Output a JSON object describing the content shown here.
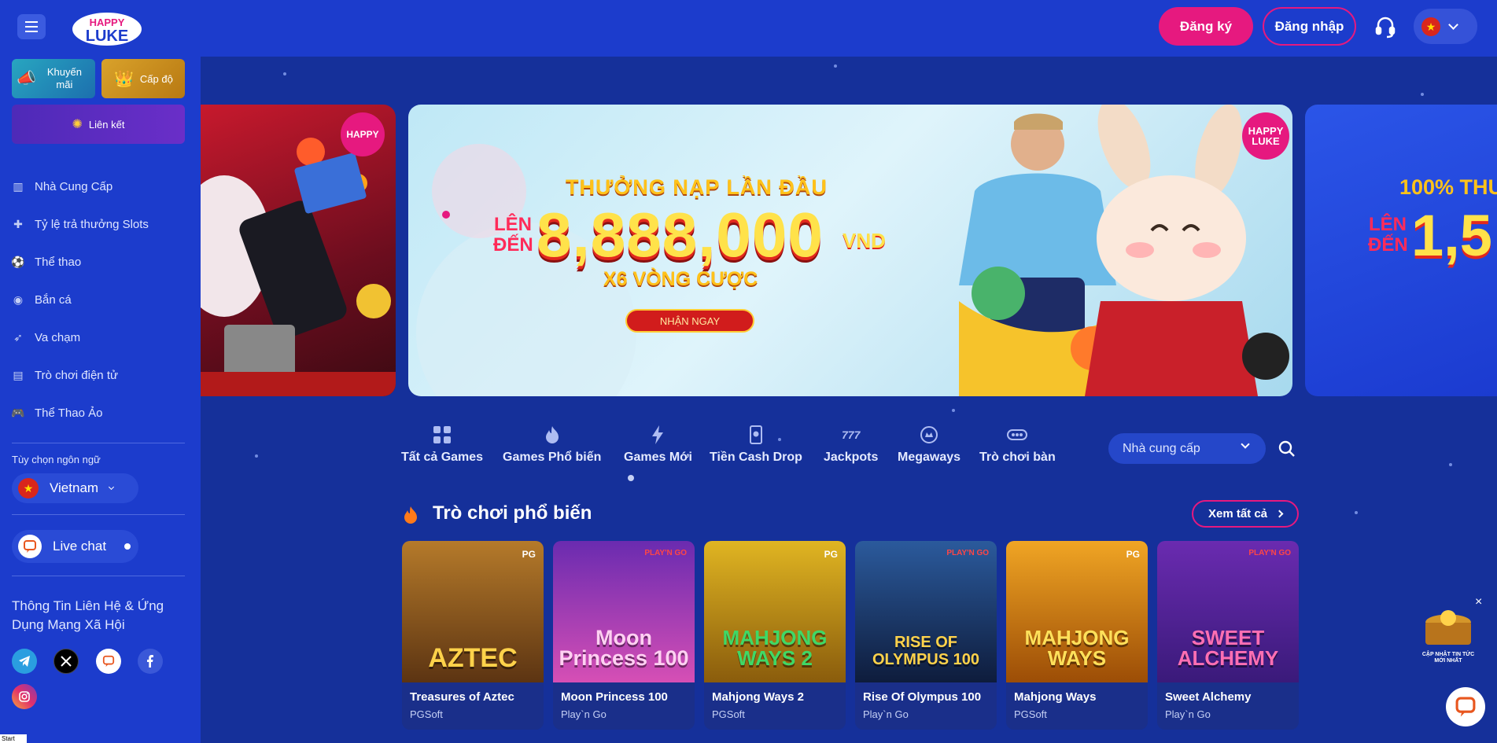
{
  "header": {
    "logo_text": "HAPPY LUKE",
    "register_label": "Đăng ký",
    "login_label": "Đăng nhập",
    "flag_color": "#d9261c"
  },
  "sidebar": {
    "promo_label": "Khuyến mãi",
    "level_label": "Cấp độ",
    "affiliate_label": "Liên kết",
    "items": [
      {
        "label": "Nhà Cung Cấp",
        "icon": "provider-icon"
      },
      {
        "label": "Tỷ lệ trả thưởng Slots",
        "icon": "puzzle-icon"
      },
      {
        "label": "Thể thao",
        "icon": "soccer-ball-icon"
      },
      {
        "label": "Bắn cá",
        "icon": "fish-icon"
      },
      {
        "label": "Va chạm",
        "icon": "rocket-icon"
      },
      {
        "label": "Trò chơi điện tử",
        "icon": "slot-machine-icon"
      },
      {
        "label": "Thể Thao Ảo",
        "icon": "gamepad-icon"
      }
    ],
    "language_label": "Tùy chọn ngôn ngữ",
    "language_value": "Vietnam",
    "livechat_label": "Live chat",
    "contact_title": "Thông Tin Liên Hệ & Ứng Dụng Mạng Xã Hội"
  },
  "banner": {
    "headline": "THƯỞNG NẠP LẦN ĐẦU",
    "prefix_line1": "LÊN",
    "prefix_line2": "ĐẾN",
    "amount": "8,888,000",
    "unit": "VND",
    "subline": "X6 VÒNG CƯỢC",
    "cta": "NHẬN NGAY",
    "logo_line1": "HAPPY",
    "logo_line2": "LUKE",
    "next_headline": "100% THƯ",
    "next_prefix1": "LÊN",
    "next_prefix2": "ĐẾN",
    "next_amount": "1,5"
  },
  "categories": [
    {
      "label": "Tất cả Games",
      "icon": "grid-icon"
    },
    {
      "label": "Games Phổ biến",
      "icon": "fire-icon"
    },
    {
      "label": "Games Mới",
      "icon": "lightning-icon"
    },
    {
      "label": "Tiền Cash Drop",
      "icon": "cash-drop-icon"
    },
    {
      "label": "Jackpots",
      "icon": "jackpot-777-icon"
    },
    {
      "label": "Megaways",
      "icon": "megaways-icon"
    },
    {
      "label": "Trò chơi bàn",
      "icon": "table-game-icon"
    }
  ],
  "filters": {
    "provider_placeholder": "Nhà cung cấp"
  },
  "section": {
    "title": "Trò chơi phổ biến",
    "view_all": "Xem tất cả"
  },
  "games": [
    {
      "name": "Treasures of Aztec",
      "provider": "PGSoft",
      "art": "AZTEC",
      "badge": "PG",
      "color": "#7a4a1a"
    },
    {
      "name": "Moon Princess 100",
      "provider": "Play`n Go",
      "art": "Moon Princess 100",
      "badge": "PLAY'N GO",
      "color": "#9b2fa8"
    },
    {
      "name": "Mahjong Ways 2",
      "provider": "PGSoft",
      "art": "MAHJONG WAYS 2",
      "badge": "PG",
      "color": "#c79a1a"
    },
    {
      "name": "Rise Of Olympus 100",
      "provider": "Play`n Go",
      "art": "RISE OF OLYMPUS 100",
      "badge": "PLAY'N GO",
      "color": "#1d3f7a"
    },
    {
      "name": "Mahjong Ways",
      "provider": "PGSoft",
      "art": "MAHJONG WAYS",
      "badge": "PG",
      "color": "#d8820f"
    },
    {
      "name": "Sweet Alchemy",
      "provider": "Play`n Go",
      "art": "SWEET ALCHEMY",
      "badge": "PLAY'N GO",
      "color": "#7b2fb8"
    }
  ],
  "widgets": {
    "news_text": "CẬP NHẬT TIN TỨC MỚI NHẤT",
    "close": "×",
    "corner_label": "Start"
  }
}
